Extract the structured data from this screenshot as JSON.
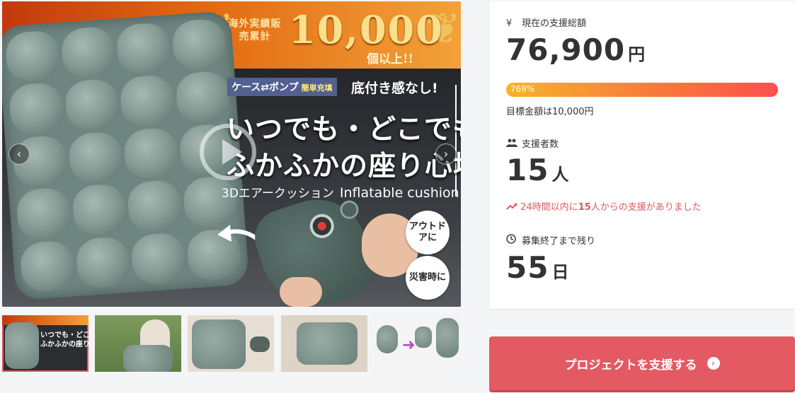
{
  "hero": {
    "banner_label": "海外実績販売累計",
    "banner_number": "10,000",
    "banner_unit": "個以上!!",
    "chip_text": "ケース⇄ポンプ",
    "chip_small": "簡単充填",
    "side_text": "底付き感なし!",
    "catch1": "いつでも・どこでも",
    "catch2": "ふかふかの座り心地",
    "subtitle_jp": "3Dエアークッション",
    "subtitle_en": "Inflatable cushion",
    "badge1": "アウトドアに",
    "badge2": "災害時に",
    "prev_label": "‹",
    "next_label": "›"
  },
  "thumbnails": {
    "t1_text_line1": "いつでも・どこでも",
    "t1_text_line2": "ふかふかの座り心地"
  },
  "stats": {
    "total_label": "現在の支援総額",
    "total_value": "76,900",
    "total_unit": "円",
    "progress_percent": "769%",
    "progress_fraction": 1.0,
    "goal_text": "目標金額は10,000円",
    "supporters_label": "支援者数",
    "supporters_value": "15",
    "supporters_unit": "人",
    "trend_prefix": "24時間以内に",
    "trend_count": "15",
    "trend_suffix": "人からの支援がありました",
    "remaining_label": "募集終了まで残り",
    "remaining_value": "55",
    "remaining_unit": "日"
  },
  "icons": {
    "yen": "¥",
    "people": "people-icon",
    "trend": "trending-up-icon",
    "clock": "clock-icon"
  },
  "colors": {
    "accent": "#e35a63",
    "trend": "#e0575f",
    "progress_start": "#f7b42c",
    "progress_end": "#ff4f4f"
  },
  "cta": {
    "label": "プロジェクトを支援する",
    "arrow": "›"
  }
}
